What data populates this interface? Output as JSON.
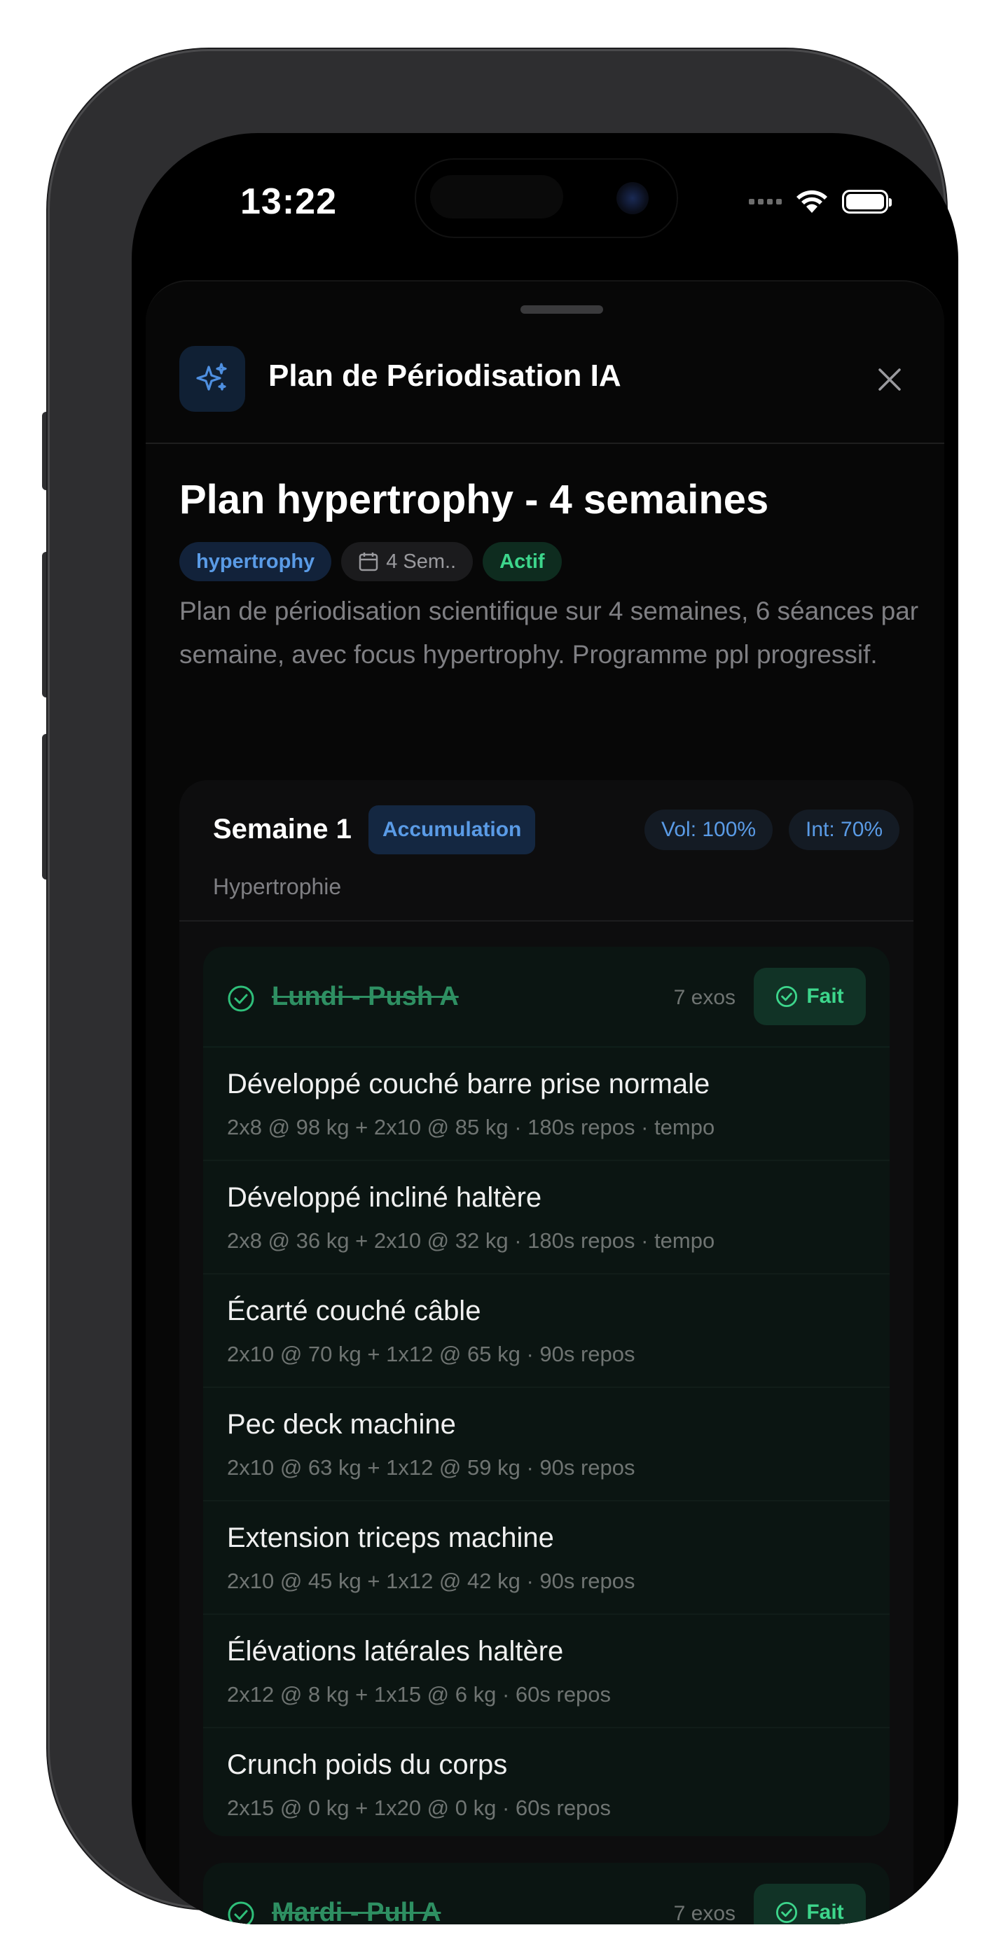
{
  "status_bar": {
    "time": "13:22"
  },
  "sheet": {
    "title": "Plan de Périodisation IA"
  },
  "plan": {
    "title": "Plan hypertrophy - 4 semaines",
    "tags": {
      "goal": "hypertrophy",
      "duration": "4 Sem..",
      "status": "Actif"
    },
    "description": "Plan de périodisation scientifique sur 4 semaines, 6 séances par semaine, avec focus hypertrophy. Programme ppl progressif."
  },
  "week": {
    "title": "Semaine 1",
    "phase": "Accumulation",
    "subtitle": "Hypertrophie",
    "volume": "Vol: 100%",
    "intensity": "Int: 70%"
  },
  "sessions": [
    {
      "name": "Lundi - Push A",
      "count": "7 exos",
      "done_label": "Fait",
      "exercises": [
        {
          "name": "Développé couché barre prise normale",
          "detail": "2x8 @ 98 kg + 2x10 @ 85 kg · 180s repos · tempo"
        },
        {
          "name": "Développé incliné haltère",
          "detail": "2x8 @ 36 kg + 2x10 @ 32 kg · 180s repos · tempo"
        },
        {
          "name": "Écarté couché câble",
          "detail": "2x10 @ 70 kg + 1x12 @ 65 kg · 90s repos"
        },
        {
          "name": "Pec deck machine",
          "detail": "2x10 @ 63 kg + 1x12 @ 59 kg · 90s repos"
        },
        {
          "name": "Extension triceps machine",
          "detail": "2x10 @ 45 kg + 1x12 @ 42 kg · 90s repos"
        },
        {
          "name": "Élévations latérales haltère",
          "detail": "2x12 @ 8 kg + 1x15 @ 6 kg · 60s repos"
        },
        {
          "name": "Crunch poids du corps",
          "detail": "2x15 @ 0 kg + 1x20 @ 0 kg · 60s repos"
        }
      ]
    },
    {
      "name": "Mardi - Pull A",
      "count": "7 exos",
      "done_label": "Fait"
    }
  ]
}
